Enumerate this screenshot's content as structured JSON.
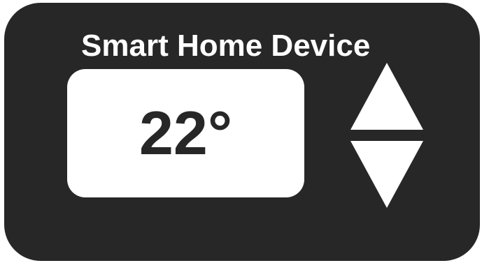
{
  "device": {
    "title": "Smart Home Device",
    "temperature_display": "22°"
  },
  "controls": {
    "increase_icon": "triangle-up-icon",
    "decrease_icon": "triangle-down-icon"
  },
  "colors": {
    "body": "#272727",
    "display_background": "#ffffff",
    "text_on_body": "#ffffff",
    "text_on_display": "#272727"
  }
}
